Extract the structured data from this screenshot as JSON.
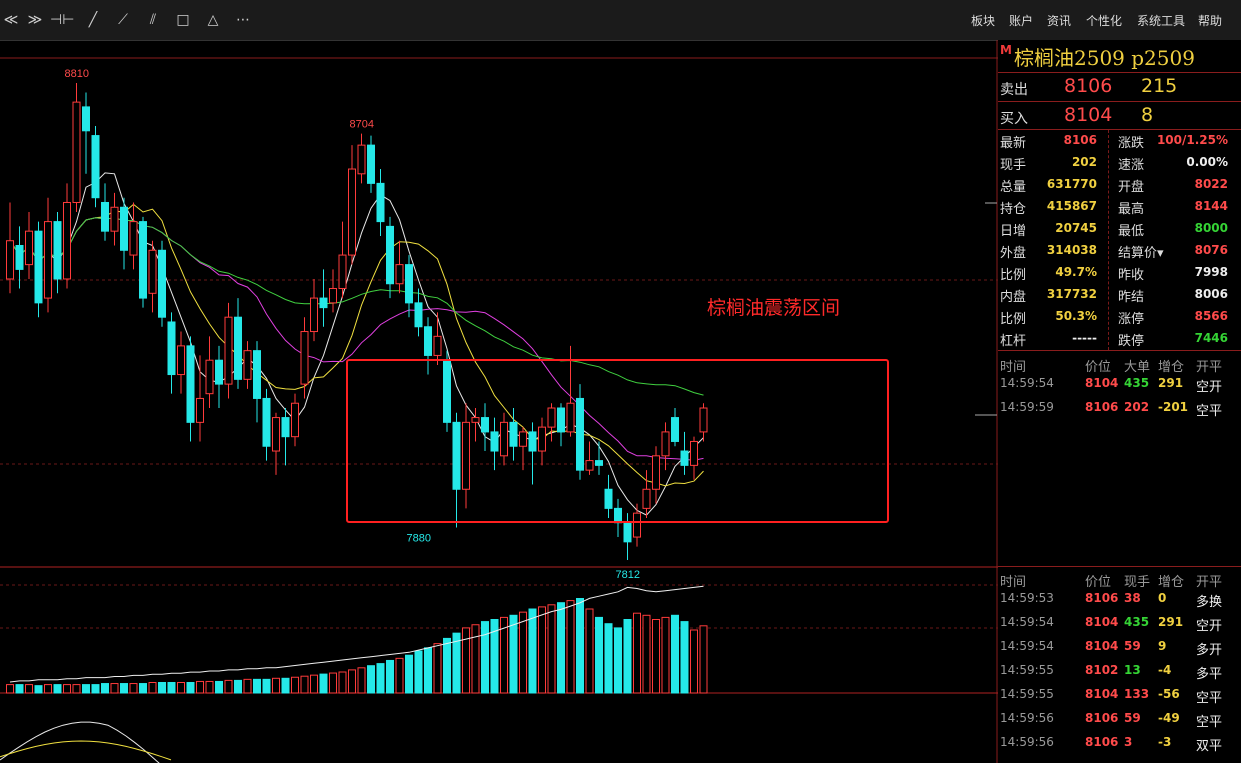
{
  "toolbar": {
    "tools": [
      {
        "name": "collapse-icon",
        "glyph": "≪"
      },
      {
        "name": "collapse-down-icon",
        "glyph": "≫"
      },
      {
        "name": "crosshair-icon",
        "glyph": "⊣⊢"
      },
      {
        "name": "line-icon",
        "glyph": "╱"
      },
      {
        "name": "ray-icon",
        "glyph": "⟋"
      },
      {
        "name": "parallel-icon",
        "glyph": "⫽"
      },
      {
        "name": "rectangle-icon",
        "glyph": "□"
      },
      {
        "name": "triangle-icon",
        "glyph": "△"
      },
      {
        "name": "more-icon",
        "glyph": "⋯"
      }
    ],
    "menu": [
      "板块",
      "账户",
      "资讯",
      "个性化",
      "系统工具",
      "帮助"
    ]
  },
  "chart_data": {
    "type": "candlestick",
    "annotation": "棕榈油震荡区间",
    "high_labels": [
      "8810",
      "8704"
    ],
    "low_labels": [
      "7880",
      "7812"
    ],
    "candles": [
      {
        "o": 8400,
        "c": 8480,
        "h": 8560,
        "l": 8370
      },
      {
        "o": 8470,
        "c": 8420,
        "h": 8510,
        "l": 8380
      },
      {
        "o": 8430,
        "c": 8500,
        "h": 8540,
        "l": 8400
      },
      {
        "o": 8500,
        "c": 8350,
        "h": 8520,
        "l": 8320
      },
      {
        "o": 8360,
        "c": 8520,
        "h": 8570,
        "l": 8330
      },
      {
        "o": 8520,
        "c": 8400,
        "h": 8540,
        "l": 8370
      },
      {
        "o": 8400,
        "c": 8560,
        "h": 8600,
        "l": 8380
      },
      {
        "o": 8560,
        "c": 8770,
        "h": 8810,
        "l": 8540
      },
      {
        "o": 8760,
        "c": 8710,
        "h": 8790,
        "l": 8620
      },
      {
        "o": 8700,
        "c": 8570,
        "h": 8720,
        "l": 8550
      },
      {
        "o": 8560,
        "c": 8500,
        "h": 8600,
        "l": 8480
      },
      {
        "o": 8500,
        "c": 8550,
        "h": 8580,
        "l": 8470
      },
      {
        "o": 8550,
        "c": 8460,
        "h": 8570,
        "l": 8420
      },
      {
        "o": 8450,
        "c": 8520,
        "h": 8560,
        "l": 8420
      },
      {
        "o": 8520,
        "c": 8360,
        "h": 8530,
        "l": 8340
      },
      {
        "o": 8370,
        "c": 8460,
        "h": 8480,
        "l": 8330
      },
      {
        "o": 8460,
        "c": 8320,
        "h": 8480,
        "l": 8300
      },
      {
        "o": 8310,
        "c": 8200,
        "h": 8330,
        "l": 8160
      },
      {
        "o": 8200,
        "c": 8260,
        "h": 8290,
        "l": 8160
      },
      {
        "o": 8260,
        "c": 8100,
        "h": 8280,
        "l": 8060
      },
      {
        "o": 8100,
        "c": 8150,
        "h": 8240,
        "l": 8060
      },
      {
        "o": 8160,
        "c": 8230,
        "h": 8280,
        "l": 8130
      },
      {
        "o": 8230,
        "c": 8180,
        "h": 8260,
        "l": 8130
      },
      {
        "o": 8180,
        "c": 8320,
        "h": 8350,
        "l": 8150
      },
      {
        "o": 8320,
        "c": 8190,
        "h": 8360,
        "l": 8170
      },
      {
        "o": 8190,
        "c": 8250,
        "h": 8270,
        "l": 8170
      },
      {
        "o": 8250,
        "c": 8150,
        "h": 8270,
        "l": 8100
      },
      {
        "o": 8150,
        "c": 8050,
        "h": 8170,
        "l": 8020
      },
      {
        "o": 8040,
        "c": 8110,
        "h": 8120,
        "l": 7990
      },
      {
        "o": 8110,
        "c": 8070,
        "h": 8130,
        "l": 8010
      },
      {
        "o": 8070,
        "c": 8140,
        "h": 8160,
        "l": 8050
      },
      {
        "o": 8180,
        "c": 8290,
        "h": 8320,
        "l": 8150
      },
      {
        "o": 8290,
        "c": 8360,
        "h": 8400,
        "l": 8270
      },
      {
        "o": 8360,
        "c": 8340,
        "h": 8420,
        "l": 8300
      },
      {
        "o": 8350,
        "c": 8380,
        "h": 8420,
        "l": 8330
      },
      {
        "o": 8380,
        "c": 8450,
        "h": 8520,
        "l": 8360
      },
      {
        "o": 8450,
        "c": 8630,
        "h": 8680,
        "l": 8430
      },
      {
        "o": 8620,
        "c": 8680,
        "h": 8704,
        "l": 8600
      },
      {
        "o": 8680,
        "c": 8600,
        "h": 8700,
        "l": 8580
      },
      {
        "o": 8600,
        "c": 8520,
        "h": 8630,
        "l": 8490
      },
      {
        "o": 8510,
        "c": 8390,
        "h": 8530,
        "l": 8360
      },
      {
        "o": 8390,
        "c": 8430,
        "h": 8480,
        "l": 8370
      },
      {
        "o": 8430,
        "c": 8350,
        "h": 8450,
        "l": 8320
      },
      {
        "o": 8350,
        "c": 8300,
        "h": 8380,
        "l": 8280
      },
      {
        "o": 8300,
        "c": 8240,
        "h": 8320,
        "l": 8200
      },
      {
        "o": 8240,
        "c": 8280,
        "h": 8330,
        "l": 8220
      },
      {
        "o": 8230,
        "c": 8100,
        "h": 8250,
        "l": 8080
      },
      {
        "o": 8100,
        "c": 7960,
        "h": 8120,
        "l": 7880
      },
      {
        "o": 7960,
        "c": 8100,
        "h": 8140,
        "l": 7920
      },
      {
        "o": 8100,
        "c": 8110,
        "h": 8130,
        "l": 8060
      },
      {
        "o": 8110,
        "c": 8080,
        "h": 8140,
        "l": 8040
      },
      {
        "o": 8080,
        "c": 8040,
        "h": 8110,
        "l": 8000
      },
      {
        "o": 8030,
        "c": 8100,
        "h": 8120,
        "l": 8010
      },
      {
        "o": 8100,
        "c": 8050,
        "h": 8130,
        "l": 8020
      },
      {
        "o": 8050,
        "c": 8080,
        "h": 8090,
        "l": 8000
      },
      {
        "o": 8080,
        "c": 8040,
        "h": 8100,
        "l": 7970
      },
      {
        "o": 8040,
        "c": 8090,
        "h": 8110,
        "l": 8010
      },
      {
        "o": 8090,
        "c": 8130,
        "h": 8140,
        "l": 8060
      },
      {
        "o": 8130,
        "c": 8080,
        "h": 8140,
        "l": 8050
      },
      {
        "o": 8080,
        "c": 8140,
        "h": 8260,
        "l": 8070
      },
      {
        "o": 8150,
        "c": 8000,
        "h": 8180,
        "l": 7980
      },
      {
        "o": 8000,
        "c": 8020,
        "h": 8060,
        "l": 7990
      },
      {
        "o": 8020,
        "c": 8010,
        "h": 8060,
        "l": 7990
      },
      {
        "o": 7960,
        "c": 7920,
        "h": 7990,
        "l": 7900
      },
      {
        "o": 7920,
        "c": 7890,
        "h": 7940,
        "l": 7860
      },
      {
        "o": 7890,
        "c": 7850,
        "h": 7910,
        "l": 7812
      },
      {
        "o": 7860,
        "c": 7910,
        "h": 7930,
        "l": 7840
      },
      {
        "o": 7920,
        "c": 7960,
        "h": 8000,
        "l": 7900
      },
      {
        "o": 7960,
        "c": 8030,
        "h": 8050,
        "l": 7930
      },
      {
        "o": 8030,
        "c": 8080,
        "h": 8100,
        "l": 8000
      },
      {
        "o": 8110,
        "c": 8060,
        "h": 8130,
        "l": 8050
      },
      {
        "o": 8040,
        "c": 8010,
        "h": 8080,
        "l": 7990
      },
      {
        "o": 8010,
        "c": 8060,
        "h": 8070,
        "l": 7980
      },
      {
        "o": 8080,
        "c": 8130,
        "h": 8140,
        "l": 8060
      }
    ],
    "volume_line": [
      10,
      11,
      11,
      12,
      12,
      12,
      13,
      13,
      14,
      14,
      14,
      15,
      15,
      16,
      16,
      17,
      17,
      18,
      18,
      19,
      19,
      20,
      20,
      21,
      21,
      22,
      22,
      23,
      23,
      24,
      25,
      26,
      27,
      28,
      29,
      30,
      31,
      32,
      33,
      34,
      35,
      36,
      37,
      39,
      41,
      43,
      45,
      47,
      49,
      51,
      53,
      56,
      59,
      62,
      65,
      68,
      71,
      74,
      76,
      79,
      82,
      86,
      88,
      90,
      92,
      96,
      95,
      93,
      92,
      93,
      94,
      95,
      96,
      97
    ],
    "volume_bars": [
      8,
      8,
      8,
      7,
      8,
      8,
      8,
      8,
      8,
      8,
      9,
      9,
      9,
      9,
      9,
      10,
      10,
      10,
      10,
      10,
      11,
      11,
      11,
      12,
      12,
      13,
      13,
      13,
      14,
      14,
      15,
      16,
      17,
      18,
      19,
      20,
      22,
      24,
      26,
      28,
      31,
      33,
      36,
      40,
      43,
      47,
      52,
      57,
      62,
      65,
      68,
      70,
      72,
      74,
      77,
      80,
      82,
      84,
      86,
      88,
      90,
      80,
      72,
      66,
      62,
      70,
      76,
      74,
      70,
      72,
      74,
      68,
      60,
      64
    ],
    "volume_colors_up": [
      1,
      0,
      1,
      0,
      1,
      0,
      1,
      1,
      0,
      0,
      0,
      1,
      0,
      1,
      0,
      1,
      0,
      0,
      1,
      0,
      1,
      1,
      0,
      1,
      0,
      1,
      0,
      0,
      1,
      0,
      1,
      1,
      1,
      0,
      1,
      1,
      1,
      1,
      0,
      0,
      0,
      1,
      0,
      0,
      0,
      1,
      0,
      0,
      1,
      1,
      0,
      0,
      1,
      0,
      1,
      0,
      1,
      1,
      0,
      1,
      0,
      1,
      0,
      0,
      0,
      0,
      1,
      1,
      1,
      1,
      0,
      0,
      1,
      1
    ]
  },
  "quote": {
    "title": "棕榈油2509  p2509",
    "m_label": "M",
    "sell_label": "卖出",
    "sell_price": "8106",
    "sell_vol": "215",
    "buy_label": "买入",
    "buy_price": "8104",
    "buy_vol": "8"
  },
  "stats": [
    {
      "k1": "最新",
      "v1": "8106",
      "c1": "red",
      "k2": "涨跌",
      "v2": "100/1.25%",
      "c2": "red"
    },
    {
      "k1": "现手",
      "v1": "202",
      "c1": "yel",
      "k2": "速涨",
      "v2": "0.00%",
      "c2": "wht"
    },
    {
      "k1": "总量",
      "v1": "631770",
      "c1": "yel",
      "k2": "开盘",
      "v2": "8022",
      "c2": "red"
    },
    {
      "k1": "持仓",
      "v1": "415867",
      "c1": "yel",
      "k2": "最高",
      "v2": "8144",
      "c2": "red"
    },
    {
      "k1": "日增",
      "v1": "20745",
      "c1": "yel",
      "k2": "最低",
      "v2": "8000",
      "c2": "grn"
    },
    {
      "k1": "外盘",
      "v1": "314038",
      "c1": "yel",
      "k2": "结算价▾",
      "v2": "8076",
      "c2": "red"
    },
    {
      "k1": "比例",
      "v1": "49.7%",
      "c1": "yel",
      "k2": "昨收",
      "v2": "7998",
      "c2": "wht"
    },
    {
      "k1": "内盘",
      "v1": "317732",
      "c1": "yel",
      "k2": "昨结",
      "v2": "8006",
      "c2": "wht"
    },
    {
      "k1": "比例",
      "v1": "50.3%",
      "c1": "yel",
      "k2": "涨停",
      "v2": "8566",
      "c2": "red"
    },
    {
      "k1": "杠杆",
      "v1": "-----",
      "c1": "wht",
      "k2": "跌停",
      "v2": "7446",
      "c2": "grn"
    }
  ],
  "trades_top": {
    "headers": [
      "时间",
      "价位",
      "大单",
      "增仓",
      "开平"
    ],
    "rows": [
      {
        "time": "14:59:54",
        "price": "8104",
        "vol": "435",
        "vc": "grn",
        "oi": "291",
        "type": "空开"
      },
      {
        "time": "14:59:59",
        "price": "8106",
        "vol": "202",
        "vc": "red",
        "oi": "-201",
        "type": "空平"
      }
    ]
  },
  "trades_bottom": {
    "headers": [
      "时间",
      "价位",
      "现手",
      "增仓",
      "开平"
    ],
    "rows": [
      {
        "time": "14:59:53",
        "price": "8106",
        "vol": "38",
        "vc": "red",
        "oi": "0",
        "type": "多换"
      },
      {
        "time": "14:59:54",
        "price": "8104",
        "vol": "435",
        "vc": "grn",
        "oi": "291",
        "type": "空开"
      },
      {
        "time": "14:59:54",
        "price": "8104",
        "vol": "59",
        "vc": "red",
        "oi": "9",
        "type": "多开"
      },
      {
        "time": "14:59:55",
        "price": "8102",
        "vol": "13",
        "vc": "grn",
        "oi": "-4",
        "type": "多平"
      },
      {
        "time": "14:59:55",
        "price": "8104",
        "vol": "133",
        "vc": "red",
        "oi": "-56",
        "type": "空平"
      },
      {
        "time": "14:59:56",
        "price": "8106",
        "vol": "59",
        "vc": "red",
        "oi": "-49",
        "type": "空平"
      },
      {
        "time": "14:59:56",
        "price": "8106",
        "vol": "3",
        "vc": "red",
        "oi": "-3",
        "type": "双平"
      }
    ]
  }
}
